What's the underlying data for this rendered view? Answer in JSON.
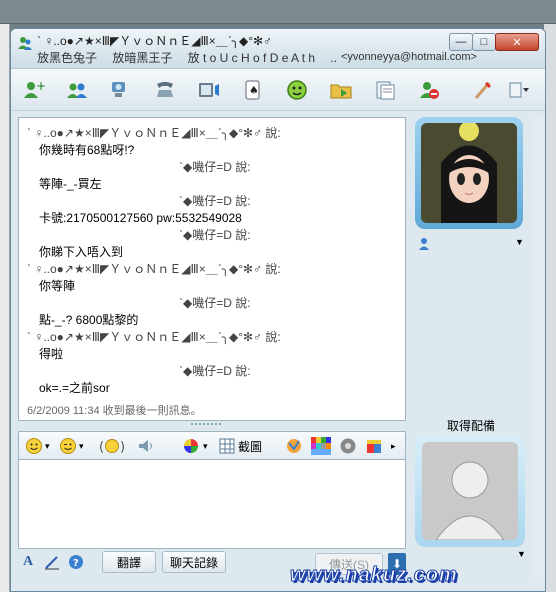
{
  "window": {
    "title_name": "ˋ ♀..o●↗★×Ⅲ◤ＹｖｏＮｎＥ◢Ⅲ×＿ˊ╮◆°✻♂",
    "title_status": "放黑色兔子　 放暗黑王子　 放 t o U c H o f D e A t h　 ...",
    "title_email": "<yvonneyya@hotmail.com>",
    "min_label": "—",
    "max_label": "□",
    "close_label": "✕"
  },
  "toolbar": {
    "items": [
      {
        "name": "invite-icon",
        "glyph": "＋"
      },
      {
        "name": "share-files-icon",
        "glyph": "▤"
      },
      {
        "name": "video-call-icon",
        "glyph": "◉"
      },
      {
        "name": "call-icon",
        "glyph": "☎"
      },
      {
        "name": "media-icon",
        "glyph": "♫"
      },
      {
        "name": "games-icon",
        "glyph": "♠"
      },
      {
        "name": "activities-icon",
        "glyph": "☺"
      },
      {
        "name": "folder-icon",
        "glyph": "▧"
      },
      {
        "name": "notes-icon",
        "glyph": "❐"
      },
      {
        "name": "block-icon",
        "glyph": "⊘"
      },
      {
        "name": "paint-icon",
        "glyph": "✎"
      },
      {
        "name": "menu-icon",
        "glyph": "▾"
      }
    ]
  },
  "chat": {
    "lines": [
      {
        "type": "sender",
        "text": "ˋ ♀..o●↗★×Ⅲ◤ＹｖｏＮｎＥ◢Ⅲ×＿ˊ╮◆°✻♂ 說:"
      },
      {
        "type": "msg",
        "text": "你幾時有68點呀!?"
      },
      {
        "type": "sender2",
        "text": "ˋ◆嘰仔=D 說:"
      },
      {
        "type": "msg",
        "text": "等陣-_-買左"
      },
      {
        "type": "sender2",
        "text": "ˋ◆嘰仔=D 說:"
      },
      {
        "type": "msg",
        "text": "卡號:2170500127560 pw:5532549028"
      },
      {
        "type": "sender2",
        "text": "ˋ◆嘰仔=D 說:"
      },
      {
        "type": "msg",
        "text": "你睇下入唔入到"
      },
      {
        "type": "sender",
        "text": "ˋ ♀..o●↗★×Ⅲ◤ＹｖｏＮｎＥ◢Ⅲ×＿ˊ╮◆°✻♂ 說:"
      },
      {
        "type": "msg",
        "text": "你等陣"
      },
      {
        "type": "sender2",
        "text": "ˋ◆嘰仔=D 說:"
      },
      {
        "type": "msg",
        "text": "點-_-? 6800點黎的"
      },
      {
        "type": "sender",
        "text": "ˋ ♀..o●↗★×Ⅲ◤ＹｖｏＮｎＥ◢Ⅲ×＿ˊ╮◆°✻♂ 說:"
      },
      {
        "type": "msg",
        "text": "得啦"
      },
      {
        "type": "sender2",
        "text": "ˋ◆嘰仔=D 說:"
      },
      {
        "type": "msg",
        "text": "ok=.=之前sor"
      }
    ],
    "status": "6/2/2009 11:34 收到最後一則訊息。"
  },
  "input_toolbar": {
    "emoticon_glyph": "☺",
    "wink_glyph": "☻",
    "nudge_glyph": "(☺)",
    "voice_glyph": "◁",
    "font_glyph": "◐",
    "screenshot_label": "截圖"
  },
  "bottom": {
    "font_label": "A",
    "translate_label": "翻譯",
    "history_label": "聊天記錄",
    "send_label": "傳送(S)",
    "send_arrow": "⬇"
  },
  "right_panel": {
    "get_picture_label": "取得配備"
  },
  "watermark": "www.nakuz.com",
  "colors": {
    "title_bar": "#dde8ef",
    "close_button": "#c3432b",
    "watermark_stroke": "#1b3fa8"
  }
}
